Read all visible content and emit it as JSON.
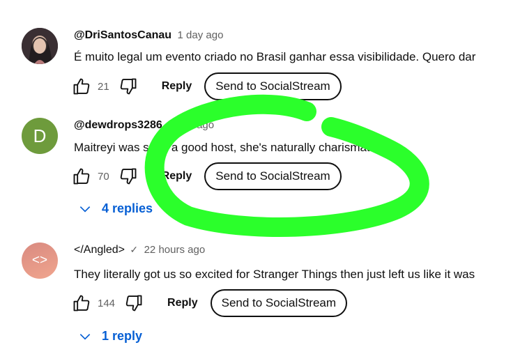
{
  "comments": [
    {
      "handle": "@DriSantosCanau",
      "time": "1 day ago",
      "text": "É muito legal um evento criado no Brasil ganhar essa visibilidade. Quero dar",
      "likes": "21",
      "reply_label": "Reply",
      "send_label": "Send to SocialStream"
    },
    {
      "avatar_letter": "D",
      "handle": "@dewdrops3286",
      "time": "1 day ago",
      "text": "Maitreyi was such a good host, she's naturally charismatic",
      "likes": "70",
      "reply_label": "Reply",
      "send_label": "Send to SocialStream",
      "replies_label": "4 replies"
    },
    {
      "avatar_text": "<>",
      "handle": "</Angled>",
      "time": "22 hours ago",
      "text": "They literally got us so excited for Stranger Things then just left us like it was",
      "likes": "144",
      "reply_label": "Reply",
      "send_label": "Send to SocialStream",
      "replies_label": "1 reply"
    }
  ],
  "colors": {
    "link_blue": "#065fd4",
    "scribble_green": "#2bff2b",
    "avatar_green": "#6e9b3c",
    "avatar_pink": "#e79a8a"
  }
}
